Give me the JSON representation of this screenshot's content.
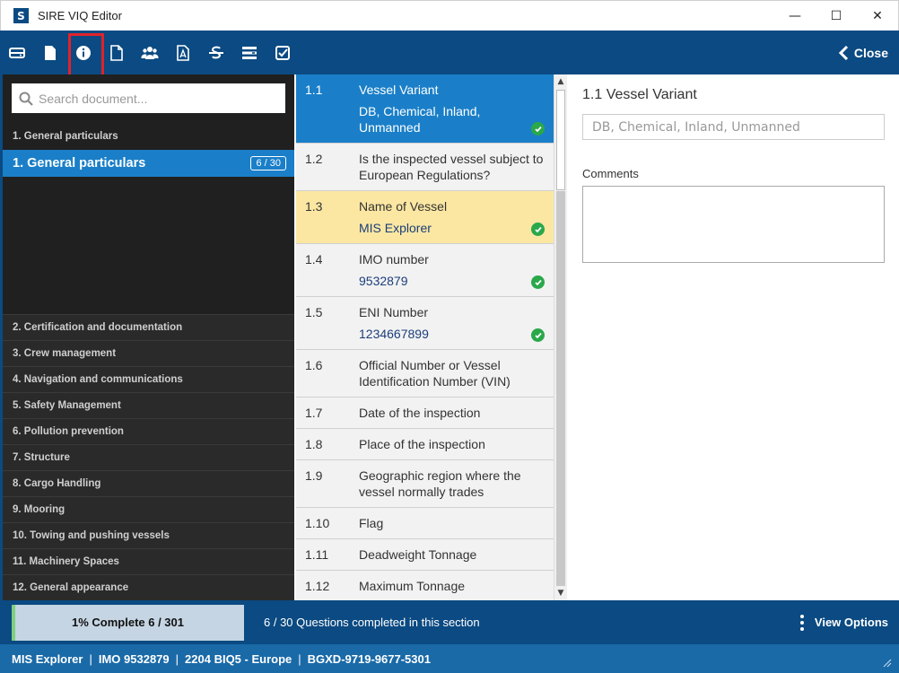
{
  "window": {
    "logo_letter": "S",
    "title": "SIRE VIQ Editor",
    "minimize": "—",
    "maximize": "☐",
    "close": "✕"
  },
  "toolbar": {
    "icons": [
      "drive-icon",
      "document-icon",
      "info-icon",
      "new-document-icon",
      "users-icon",
      "pdf-icon",
      "strikethrough-icon",
      "list-icon",
      "checklist-icon"
    ],
    "selected_icon": "info-icon",
    "close_label": "Close"
  },
  "sidebar": {
    "search_placeholder": "Search document...",
    "current_header": "1. General particulars",
    "active_section": {
      "label": "1.  General particulars",
      "badge": "6 / 30"
    },
    "sections": [
      "2. Certification and documentation",
      "3. Crew management",
      "4. Navigation and communications",
      "5. Safety Management",
      "6. Pollution prevention",
      "7. Structure",
      "8. Cargo Handling",
      "9. Mooring",
      "10. Towing and pushing vessels",
      "11. Machinery Spaces",
      "12. General appearance"
    ]
  },
  "questions": [
    {
      "num": "1.1",
      "label": "Vessel Variant",
      "answer": "DB, Chemical, Inland, Unmanned",
      "state": "active",
      "done": true
    },
    {
      "num": "1.2",
      "label": "Is the inspected vessel subject to European Regulations?",
      "answer": "",
      "state": "",
      "done": false
    },
    {
      "num": "1.3",
      "label": "Name of Vessel",
      "answer": "MIS Explorer",
      "state": "highlight",
      "done": true
    },
    {
      "num": "1.4",
      "label": "IMO number",
      "answer": "9532879",
      "state": "",
      "done": true
    },
    {
      "num": "1.5",
      "label": "ENI Number",
      "answer": "1234667899",
      "state": "",
      "done": true
    },
    {
      "num": "1.6",
      "label": "Official Number or Vessel Identification Number (VIN)",
      "answer": "",
      "state": "",
      "done": false
    },
    {
      "num": "1.7",
      "label": "Date of the inspection",
      "answer": "",
      "state": "",
      "done": false
    },
    {
      "num": "1.8",
      "label": "Place of the inspection",
      "answer": "",
      "state": "",
      "done": false
    },
    {
      "num": "1.9",
      "label": "Geographic region where the vessel normally trades",
      "answer": "",
      "state": "",
      "done": false
    },
    {
      "num": "1.10",
      "label": "Flag",
      "answer": "",
      "state": "",
      "done": false
    },
    {
      "num": "1.11",
      "label": "Deadweight Tonnage",
      "answer": "",
      "state": "",
      "done": false
    },
    {
      "num": "1.12",
      "label": "Maximum Tonnage",
      "answer": "",
      "state": "",
      "done": false
    },
    {
      "num": "",
      "label": "",
      "answer": "",
      "state": "",
      "done": false
    }
  ],
  "scrollbar": {
    "up": "▲",
    "down": "▼"
  },
  "detail": {
    "title": "1.1 Vessel Variant",
    "value": "DB, Chemical, Inland, Unmanned",
    "comments_label": "Comments",
    "comments_value": ""
  },
  "progress": {
    "percent": 1,
    "text": "1% Complete 6 / 301",
    "section_note": "6 / 30 Questions completed in this section",
    "view_options": "View Options"
  },
  "status": {
    "vessel": "MIS Explorer",
    "imo": "IMO 9532879",
    "version": "2204 BIQ5 - Europe",
    "code": "BGXD-9719-9677-5301"
  },
  "colors": {
    "brand": "#0b4a82",
    "accent": "#1a7fc8",
    "highlight": "#fbe7a2",
    "check": "#2aa84a",
    "selected_outline": "#e0222b"
  }
}
